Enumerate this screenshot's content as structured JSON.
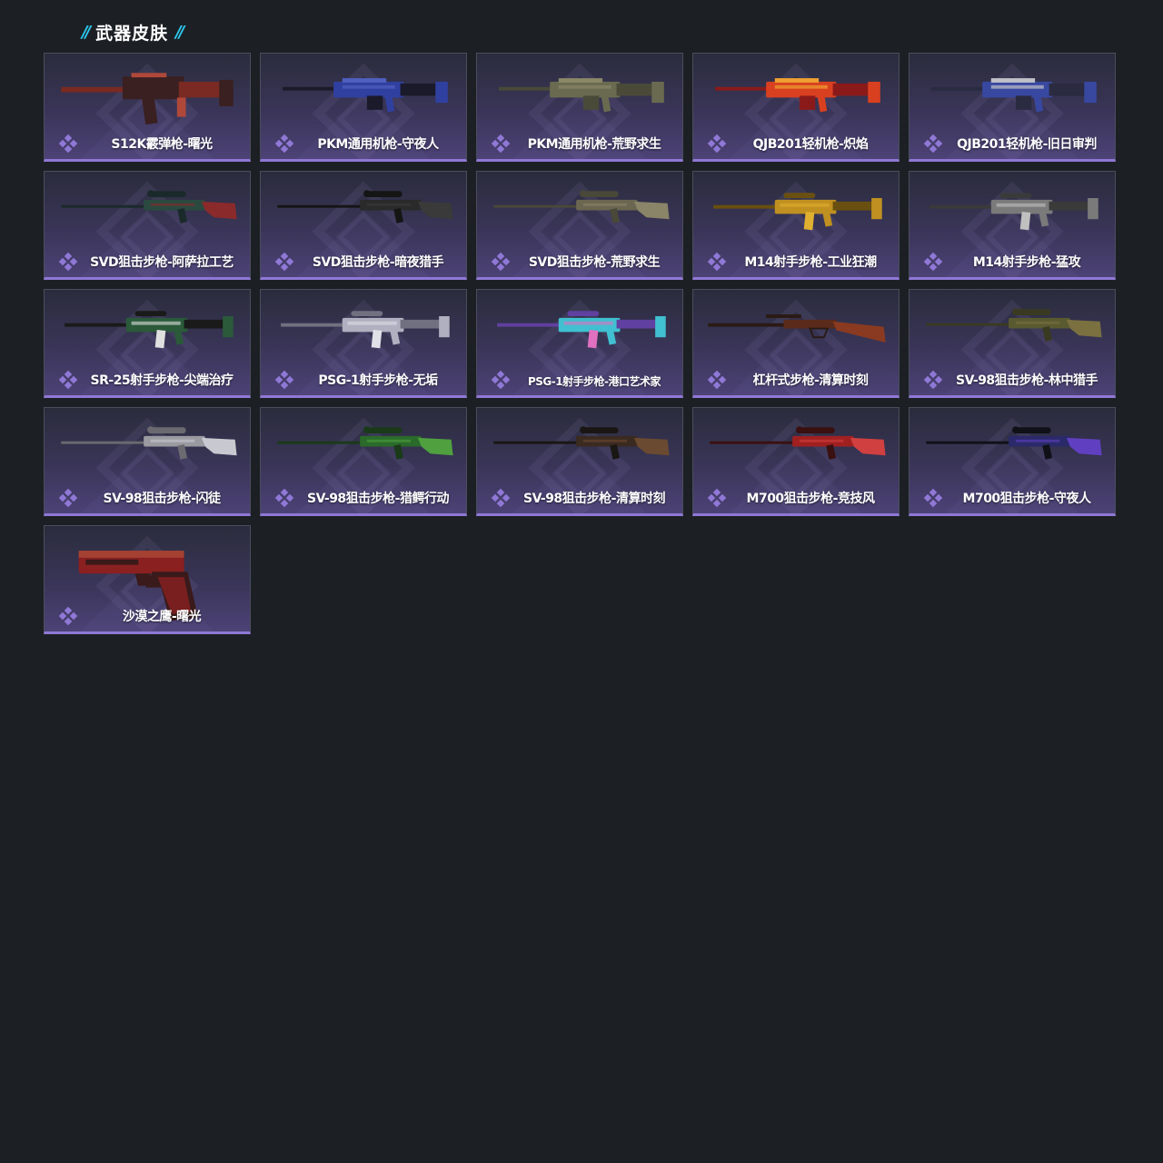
{
  "header": {
    "slash_left": "//",
    "title": "武器皮肤",
    "slash_right": "//"
  },
  "colors": {
    "background": "#1c2024",
    "accent_cyan": "#2cc8ee",
    "rarity_purple": "#8f78d6",
    "card_gradient_top": "#2a2c3c",
    "card_gradient_bottom": "#4c4276"
  },
  "skins": [
    {
      "name": "S12K霰弹枪-曙光",
      "icon": "shotgun-icon",
      "colors": [
        "#7a2a22",
        "#3a2020",
        "#b0483a"
      ]
    },
    {
      "name": "PKM通用机枪-守夜人",
      "icon": "machine-gun-icon",
      "colors": [
        "#1a1a2a",
        "#3040a0",
        "#5060c0"
      ]
    },
    {
      "name": "PKM通用机枪-荒野求生",
      "icon": "machine-gun-icon",
      "colors": [
        "#4a4a38",
        "#6a6a50",
        "#8a8868"
      ]
    },
    {
      "name": "QJB201轻机枪-炽焰",
      "icon": "machine-gun-icon",
      "colors": [
        "#8a1a1a",
        "#d84020",
        "#f0a030"
      ]
    },
    {
      "name": "QJB201轻机枪-旧日审判",
      "icon": "machine-gun-icon",
      "colors": [
        "#2a2a40",
        "#3848a0",
        "#c0c0c8"
      ]
    },
    {
      "name": "SVD狙击步枪-阿萨拉工艺",
      "icon": "sniper-rifle-icon",
      "colors": [
        "#1a2a2a",
        "#2a4a40",
        "#8a2a2a"
      ]
    },
    {
      "name": "SVD狙击步枪-暗夜猎手",
      "icon": "sniper-rifle-icon",
      "colors": [
        "#151515",
        "#2a2a2a",
        "#3a3a3a"
      ]
    },
    {
      "name": "SVD狙击步枪-荒野求生",
      "icon": "sniper-rifle-icon",
      "colors": [
        "#4a4838",
        "#6a6650",
        "#8a8468"
      ]
    },
    {
      "name": "M14射手步枪-工业狂潮",
      "icon": "marksman-rifle-icon",
      "colors": [
        "#6a5010",
        "#c09020",
        "#e0b030"
      ]
    },
    {
      "name": "M14射手步枪-猛攻",
      "icon": "marksman-rifle-icon",
      "colors": [
        "#3a3a3a",
        "#7a7a7a",
        "#c0c0c0"
      ]
    },
    {
      "name": "SR-25射手步枪-尖端治疗",
      "icon": "marksman-rifle-icon",
      "colors": [
        "#1a1a1a",
        "#2a5a3a",
        "#e0e0e0"
      ]
    },
    {
      "name": "PSG-1射手步枪-无垢",
      "icon": "marksman-rifle-icon",
      "colors": [
        "#707080",
        "#b0b0c0",
        "#e0e0e8"
      ]
    },
    {
      "name": "PSG-1射手步枪-港口艺术家",
      "icon": "marksman-rifle-icon",
      "colors": [
        "#6040a0",
        "#40c0d0",
        "#e070c0"
      ]
    },
    {
      "name": "杠杆式步枪-清算时刻",
      "icon": "lever-rifle-icon",
      "colors": [
        "#2a1a14",
        "#5a2a1a",
        "#8a3a20"
      ]
    },
    {
      "name": "SV-98狙击步枪-林中猎手",
      "icon": "sniper-rifle-icon",
      "colors": [
        "#3a3a22",
        "#5a5a30",
        "#7a7040"
      ]
    },
    {
      "name": "SV-98狙击步枪-闪徒",
      "icon": "sniper-rifle-icon",
      "colors": [
        "#6a6a70",
        "#9a9aa0",
        "#c8c8d0"
      ]
    },
    {
      "name": "SV-98狙击步枪-猎鳄行动",
      "icon": "sniper-rifle-icon",
      "colors": [
        "#1a3a1a",
        "#2a6a2a",
        "#50a040"
      ]
    },
    {
      "name": "SV-98狙击步枪-清算时刻",
      "icon": "sniper-rifle-icon",
      "colors": [
        "#1a1614",
        "#3a2a20",
        "#6a4a30"
      ]
    },
    {
      "name": "M700狙击步枪-竞技风",
      "icon": "sniper-rifle-icon",
      "colors": [
        "#3a1010",
        "#a02020",
        "#d04040"
      ]
    },
    {
      "name": "M700狙击步枪-守夜人",
      "icon": "sniper-rifle-icon",
      "colors": [
        "#101018",
        "#2a2a6a",
        "#6040c0"
      ]
    },
    {
      "name": "沙漠之鹰-曙光",
      "icon": "pistol-icon",
      "colors": [
        "#3a1a1a",
        "#8a2020",
        "#b0503a"
      ]
    }
  ]
}
